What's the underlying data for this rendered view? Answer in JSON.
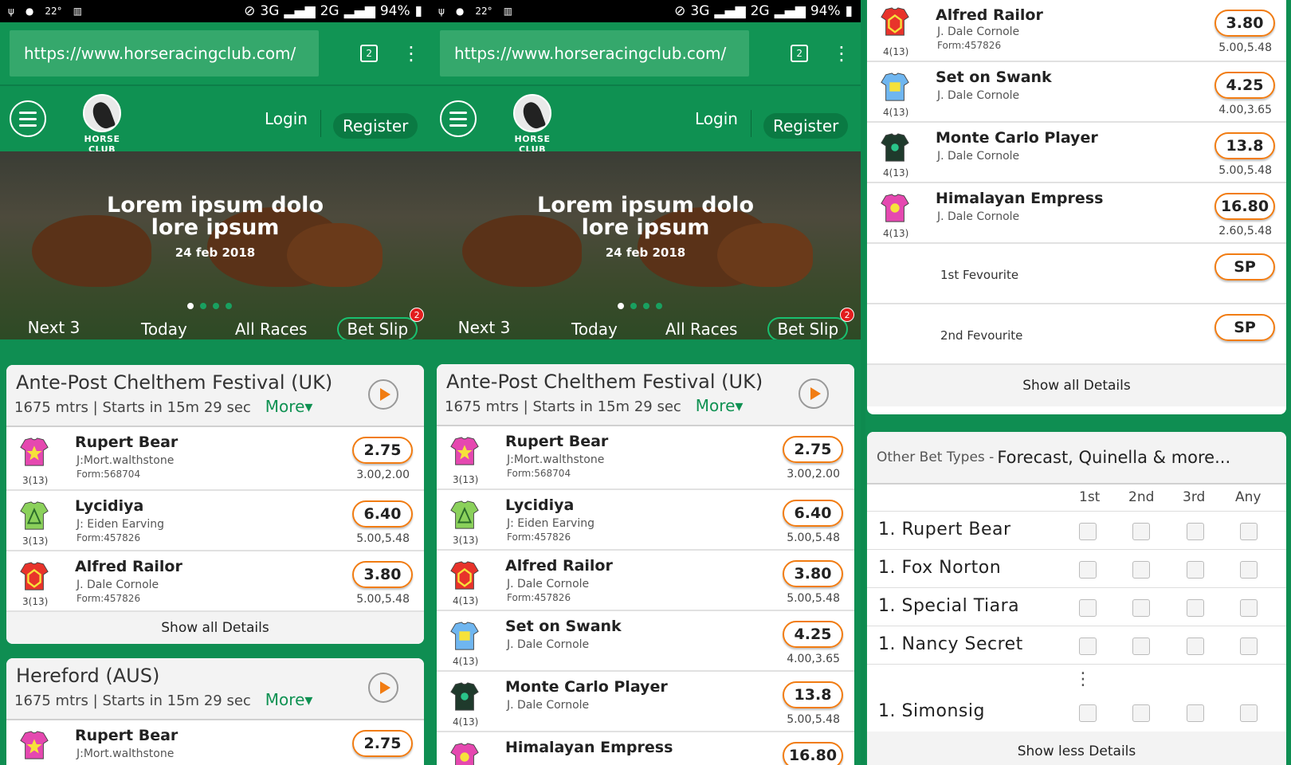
{
  "status": {
    "signal_3g": "3G",
    "signal_2g": "2G",
    "battery": "94%",
    "temp": "22°"
  },
  "browser": {
    "url": "https://www.horseracingclub.com/",
    "tabs": "2"
  },
  "header": {
    "logo": "HORSE CLUB",
    "login": "Login",
    "register": "Register"
  },
  "hero": {
    "line1": "Lorem ipsum dolo",
    "line2": "lore ipsum",
    "date": "24 feb 2018"
  },
  "tabs": {
    "next": "Next 3",
    "today": "Today",
    "all": "All Races",
    "betslip": "Bet Slip",
    "badge": "2"
  },
  "race1": {
    "title": "Ante-Post Chelthem Festival (UK)",
    "dist": "1675 mtrs",
    "sep": "|",
    "starts": "Starts in 15m 29 sec",
    "more": "More▾"
  },
  "race2": {
    "title": "Hereford (AUS)",
    "dist": "1675 mtrs",
    "sep": "|",
    "starts": "Starts in 15m 29 sec",
    "more": "More▾"
  },
  "runners": [
    {
      "name": "Rupert Bear",
      "jockey": "J:Mort.walthstone",
      "form": "Form:568704",
      "odds": "2.75",
      "sub": "3.00,2.00",
      "pos": "3(13)",
      "color": "#e548b0"
    },
    {
      "name": "Lycidiya",
      "jockey": "J: Eiden Earving",
      "form": "Form:457826",
      "odds": "6.40",
      "sub": "5.00,5.48",
      "pos": "3(13)",
      "color": "#8bd15b"
    },
    {
      "name": "Alfred Railor",
      "jockey": "J. Dale Cornole",
      "form": "Form:457826",
      "odds": "3.80",
      "sub": "5.00,5.48",
      "pos": "3(13)",
      "pos2": "4(13)",
      "color": "#e8332b"
    },
    {
      "name": "Set on Swank",
      "jockey": "J. Dale Cornole",
      "form": "",
      "odds": "4.25",
      "sub": "4.00,3.65",
      "pos": "4(13)",
      "color": "#6fb6f0"
    },
    {
      "name": "Monte Carlo Player",
      "jockey": "J. Dale Cornole",
      "form": "",
      "odds": "13.8",
      "sub": "5.00,5.48",
      "pos": "4(13)",
      "color": "#1f3a2c"
    },
    {
      "name": "Himalayan Empress",
      "jockey": "J. Dale Cornole",
      "form": "",
      "odds": "16.80",
      "sub": "2.60,5.48",
      "pos": "4(13)",
      "color": "#e548b0"
    }
  ],
  "fav1": {
    "label": "1st Fevourite",
    "odds": "SP"
  },
  "fav2": {
    "label": "2nd Fevourite",
    "odds": "SP"
  },
  "show_all": "Show all Details",
  "show_less": "Show less Details",
  "other": {
    "prefix": "Other Bet  Types -",
    "types": "Forecast, Quinella & more...",
    "cols": [
      "1st",
      "2nd",
      "3rd",
      "Any"
    ],
    "rows": [
      "1. Rupert Bear",
      "1. Fox Norton",
      "1. Special Tiara",
      "1. Nancy Secret",
      "1. Simonsig"
    ],
    "ellipsis": "⋮"
  }
}
